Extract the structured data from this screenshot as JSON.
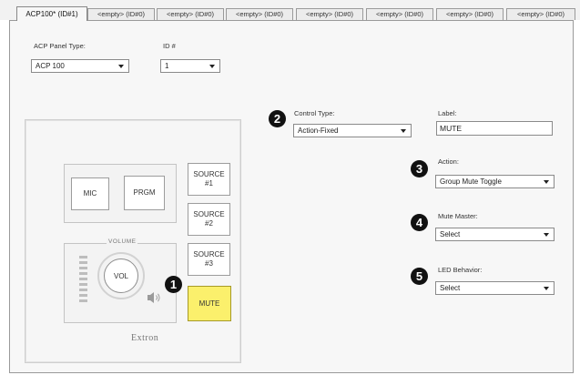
{
  "tabs": [
    {
      "label": "ACP100* (ID#1)",
      "active": true
    },
    {
      "label": "<empty> (ID#0)"
    },
    {
      "label": "<empty> (ID#0)"
    },
    {
      "label": "<empty> (ID#0)"
    },
    {
      "label": "<empty> (ID#0)"
    },
    {
      "label": "<empty> (ID#0)"
    },
    {
      "label": "<empty> (ID#0)"
    },
    {
      "label": "<empty> (ID#0)"
    }
  ],
  "panel_type": {
    "label": "ACP Panel Type:",
    "value": "ACP 100"
  },
  "id_field": {
    "label": "ID #",
    "value": "1"
  },
  "control_type": {
    "label": "Control Type:",
    "value": "Action-Fixed"
  },
  "label_field": {
    "label": "Label:",
    "value": "MUTE"
  },
  "action": {
    "label": "Action:",
    "value": "Group Mute Toggle"
  },
  "mute_master": {
    "label": "Mute Master:",
    "value": "Select"
  },
  "led_behavior": {
    "label": "LED Behavior:",
    "value": "Select"
  },
  "device": {
    "mic": "MIC",
    "prgm": "PRGM",
    "source1": "SOURCE\n#1",
    "source2": "SOURCE\n#2",
    "source3": "SOURCE\n#3",
    "mute": "MUTE",
    "volume_label": "VOLUME",
    "knob": "VOL",
    "brand": "Extron"
  },
  "callouts": [
    "1",
    "2",
    "3",
    "4",
    "5"
  ],
  "icons": {
    "speaker": "speaker-icon",
    "dropdown": "chevron-down-icon"
  },
  "colors": {
    "mute_button": "#fbf06c",
    "callout": "#111111"
  }
}
